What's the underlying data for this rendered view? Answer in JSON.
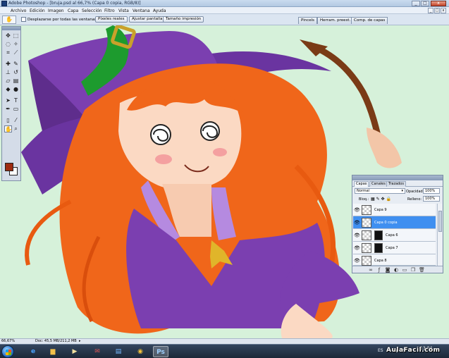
{
  "window": {
    "title": "Adobe Photoshop - [bruja.psd al 66,7% (Capa 0 copia, RGB/8)]",
    "controls": [
      "_",
      "□",
      "x"
    ],
    "doc_controls": [
      "_",
      "□",
      "x"
    ]
  },
  "menu": {
    "items": [
      "Archivo",
      "Edición",
      "Imagen",
      "Capa",
      "Selección",
      "Filtro",
      "Vista",
      "Ventana",
      "Ayuda"
    ]
  },
  "options": {
    "checkbox_label": "Desplazarse por todas las ventanas",
    "checkbox_checked": false,
    "buttons": [
      "Píxeles reales",
      "Ajustar pantalla",
      "Tamaño impresión"
    ]
  },
  "panel_tabs": [
    "Pincels",
    "Herram. preest.",
    "Comp. de capas"
  ],
  "toolbox": {
    "foreground_color": "#9e2b10",
    "background_color": "#ffffff",
    "selected_tool": "hand-tool"
  },
  "layers_panel": {
    "tabs": [
      "Capas",
      "Canales",
      "Trazados"
    ],
    "active_tab": "Capas",
    "blend_mode": "Normal",
    "opacity_label": "Opacidad:",
    "opacity_value": "100%",
    "lock_label": "Bloq.:",
    "fill_label": "Relleno:",
    "fill_value": "100%",
    "layers": [
      {
        "name": "Capa 9",
        "visible": true,
        "selected": false,
        "mask": false
      },
      {
        "name": "Capa 0 copia",
        "visible": true,
        "selected": true,
        "mask": false
      },
      {
        "name": "Capa 6",
        "visible": true,
        "selected": false,
        "mask": true
      },
      {
        "name": "Capa 7",
        "visible": true,
        "selected": false,
        "mask": true
      },
      {
        "name": "Capa 8",
        "visible": true,
        "selected": false,
        "mask": false
      }
    ]
  },
  "status": {
    "zoom": "66,67%",
    "doc": "Doc: 45,5 MB/211,2 MB"
  },
  "taskbar": {
    "language": "ES",
    "time": "13:04",
    "watermark": "AulaFacil.com"
  },
  "colors": {
    "canvas_bg": "#d6f1da",
    "hair": "#f0661a",
    "hat": "#7b3fb0",
    "hat_band": "#1d9b2e",
    "buckle": "#c9a12a",
    "selected_layer": "#3f8ff0"
  }
}
